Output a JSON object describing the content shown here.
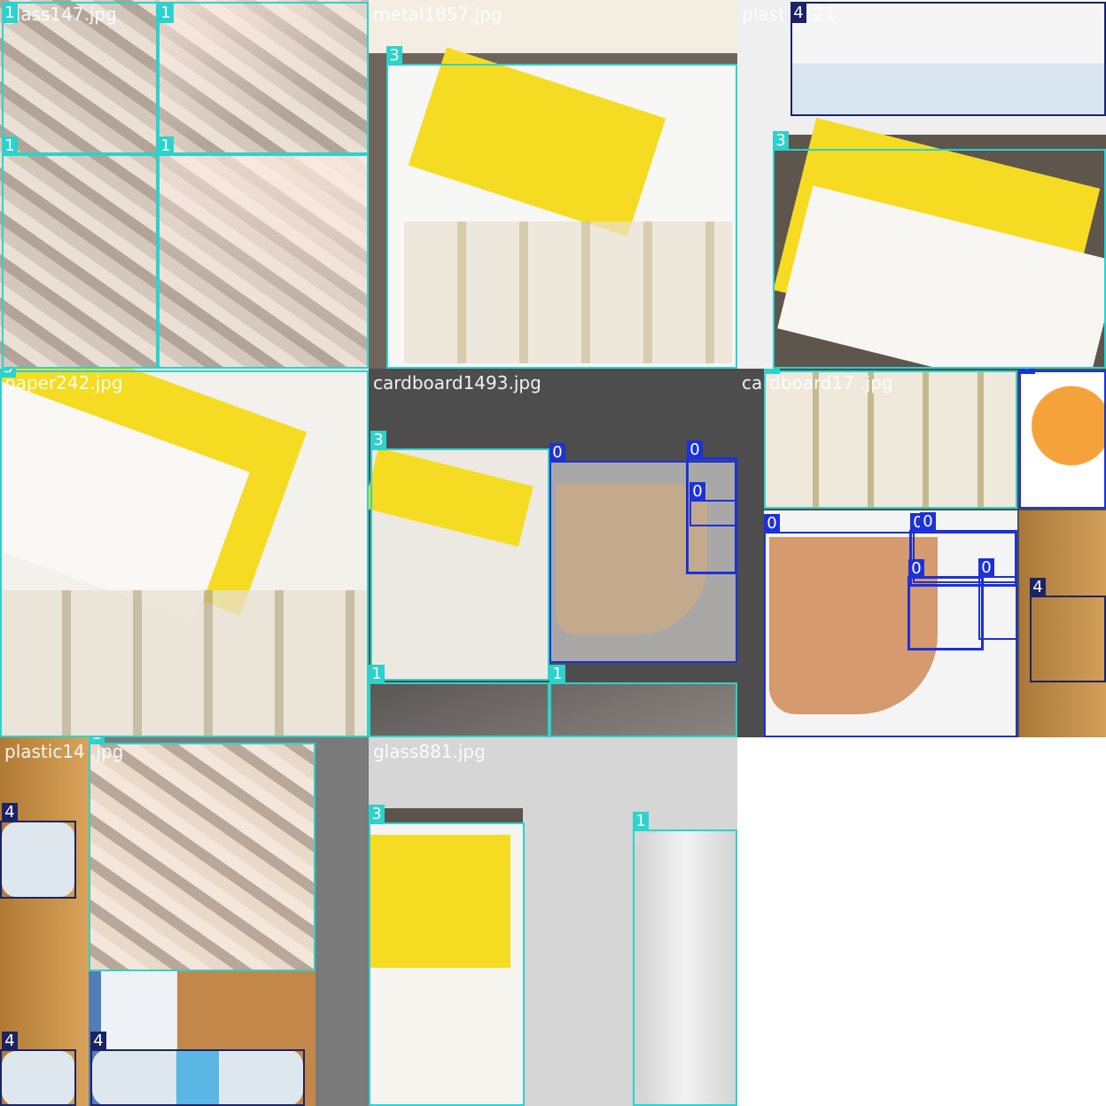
{
  "grid": {
    "tiles": [
      {
        "id": "t1",
        "name": "glass147.jpg",
        "title": "glass147.jpg"
      },
      {
        "id": "t2",
        "name": "metal1857.jpg",
        "title": "metal1857.jpg"
      },
      {
        "id": "t3",
        "name": "plastic2121",
        "title": "plast  2121"
      },
      {
        "id": "t4",
        "name": "paper242.jpg",
        "title": "paper242.jpg"
      },
      {
        "id": "t5",
        "name": "cardboard1493.jpg",
        "title": "cardboard1493.jpg"
      },
      {
        "id": "t6",
        "name": "cardboard17",
        "title": "cardboard17  .jpg"
      },
      {
        "id": "t7",
        "name": "plastic14",
        "title": "plastic14  .jpg"
      },
      {
        "id": "t8",
        "name": "glass881.jpg",
        "title": "glass881.jpg"
      }
    ]
  },
  "box_labels": {
    "cls0": "0",
    "cls1": "1",
    "cls3": "3",
    "cls4": "4"
  },
  "class_colors": {
    "0": "#1c31d8",
    "1": "#2cd2cc",
    "3": "#2cd2cc",
    "4": "#1b2366"
  }
}
